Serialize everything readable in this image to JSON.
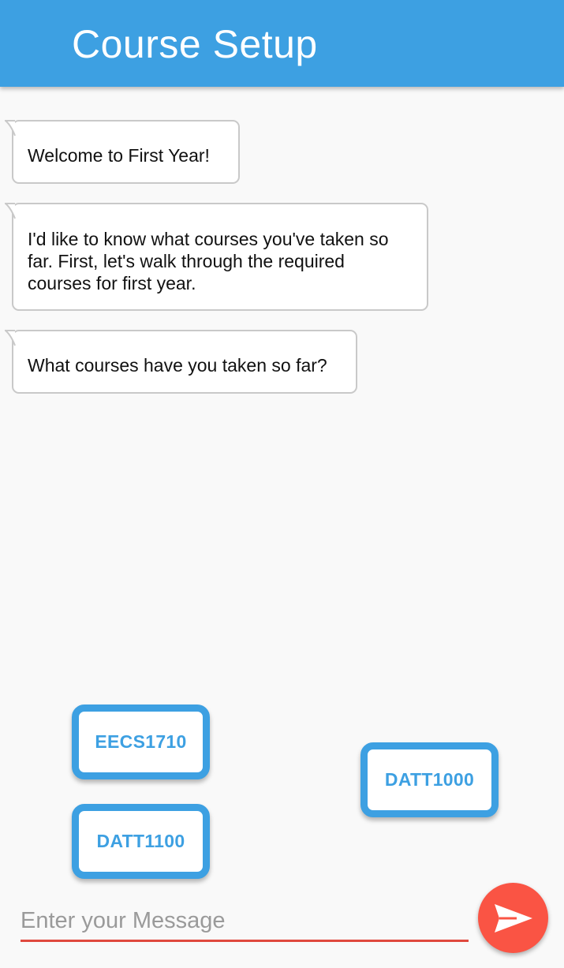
{
  "app_bar": {
    "title": "Course Setup",
    "color": "#3da0e2"
  },
  "messages": [
    {
      "text": "Welcome to First Year!"
    },
    {
      "text": "I'd like to know what courses you've taken so far. First, let's walk through the required courses for first year."
    },
    {
      "text": "What courses have you taken so far?"
    }
  ],
  "course_options": [
    {
      "label": "EECS1710"
    },
    {
      "label": "DATT1000"
    },
    {
      "label": "DATT1100"
    }
  ],
  "composer": {
    "placeholder": "Enter your Message",
    "value": "",
    "send_icon": "send-icon",
    "accent_color": "#fa5444"
  }
}
